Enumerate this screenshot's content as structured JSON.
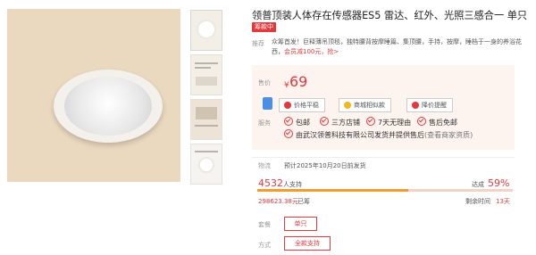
{
  "product": {
    "title": "领普顶装人体存在传感器ES5 雷达、红外、光照三感合一 单只",
    "badge": "筹款中"
  },
  "recommend": {
    "label": "推荐",
    "text": "众筹首发！巨释薄吊顶毯，独特腰背按摩睡篇、集顶腰，手持，按摩，睡档于一身的养浴花西，",
    "highlight": "会员减100元，抢>"
  },
  "price": {
    "label": "售价",
    "currency": "¥",
    "value": "69"
  },
  "service_buttons": [
    {
      "label": "价格平稳",
      "icon": "price-trend-icon"
    },
    {
      "label": "商城相似款",
      "icon": "similar-icon"
    },
    {
      "label": "降价提醒",
      "icon": "bell-icon"
    }
  ],
  "services": {
    "label": "服务",
    "items": [
      "包邮",
      "三方店铺",
      "7天无理由",
      "售后免邮"
    ],
    "seller": "由武汉领普科技有限公司发货并提供售后",
    "seller_link": "(查看商家资质)"
  },
  "delivery": {
    "label": "物流",
    "text": "预计2025年10月20日前发货"
  },
  "crowdfunding": {
    "supporters": "4532",
    "supporters_unit": "人支持",
    "rate_label": "达成",
    "rate": "59%",
    "progress": 0.59,
    "amount": "298623.38元",
    "amount_unit": "已筹",
    "remain_label": "剩余时间",
    "remain": "13天"
  },
  "options": {
    "package_label": "套餐",
    "package_value": "单只",
    "payment_label": "方式",
    "payment_value": "全款支持"
  },
  "colors": {
    "accent": "#e4393c",
    "progress": "#f49b2e",
    "price_bg": "#fdf3ef"
  }
}
